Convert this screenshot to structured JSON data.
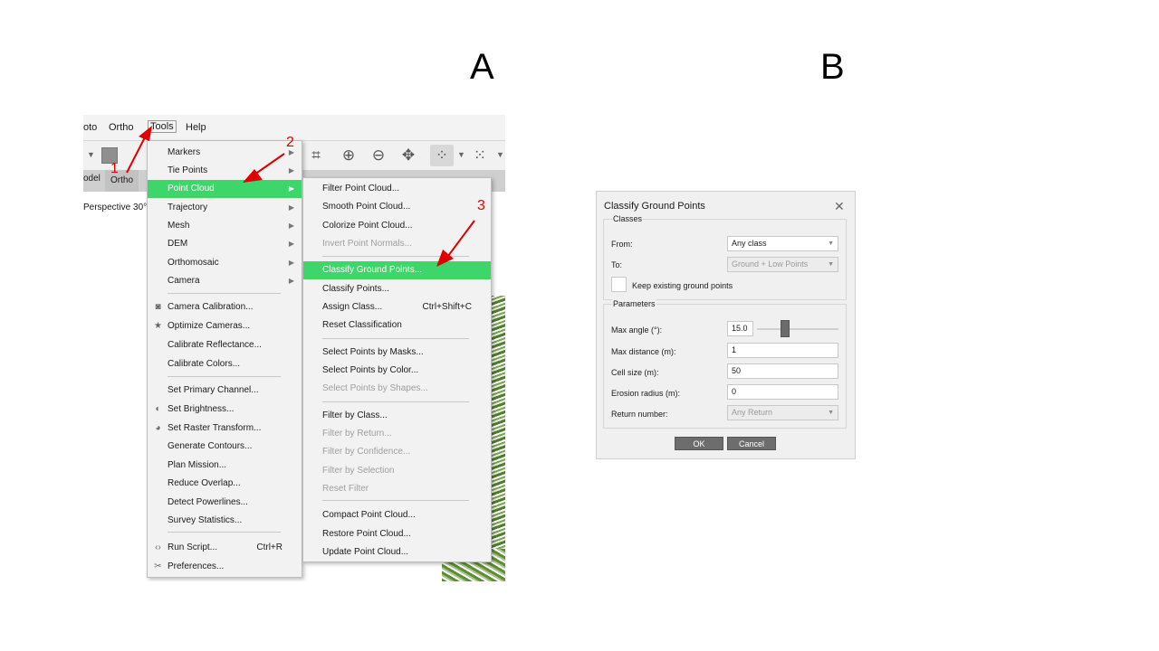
{
  "panel_labels": {
    "a": "A",
    "b": "B"
  },
  "menubar": {
    "photo": "oto",
    "ortho": "Ortho",
    "tools": "Tools",
    "help": "Help"
  },
  "tabs": {
    "model": "odel",
    "ortho": "Ortho"
  },
  "viewport": {
    "perspective": "Perspective 30°"
  },
  "annotations": {
    "one": "1",
    "two": "2",
    "three": "3",
    "color": "#e00000"
  },
  "tools_menu": {
    "items": [
      {
        "label": "Markers",
        "submenu": true
      },
      {
        "label": "Tie Points",
        "submenu": true
      },
      {
        "label": "Point Cloud",
        "submenu": true,
        "highlighted": true
      },
      {
        "label": "Trajectory",
        "submenu": true
      },
      {
        "label": "Mesh",
        "submenu": true
      },
      {
        "label": "DEM",
        "submenu": true
      },
      {
        "label": "Orthomosaic",
        "submenu": true
      },
      {
        "label": "Camera",
        "submenu": true
      },
      {
        "label": "Camera Calibration...",
        "icon": "camera-icon"
      },
      {
        "label": "Optimize Cameras...",
        "icon": "star-icon"
      },
      {
        "label": "Calibrate Reflectance..."
      },
      {
        "label": "Calibrate Colors..."
      },
      {
        "label": "Set Primary Channel..."
      },
      {
        "label": "Set Brightness...",
        "icon": "contrast-icon"
      },
      {
        "label": "Set Raster Transform...",
        "icon": "palette-icon"
      },
      {
        "label": "Generate Contours..."
      },
      {
        "label": "Plan Mission..."
      },
      {
        "label": "Reduce Overlap..."
      },
      {
        "label": "Detect Powerlines..."
      },
      {
        "label": "Survey Statistics..."
      },
      {
        "label": "Run Script...",
        "icon": "code-icon",
        "shortcut": "Ctrl+R"
      },
      {
        "label": "Preferences...",
        "icon": "tools-icon"
      }
    ]
  },
  "point_cloud_menu": {
    "items": [
      {
        "label": "Filter Point Cloud..."
      },
      {
        "label": "Smooth Point Cloud..."
      },
      {
        "label": "Colorize Point Cloud..."
      },
      {
        "label": "Invert Point Normals...",
        "disabled": true
      },
      {
        "label": "Classify Ground Points...",
        "highlighted": true
      },
      {
        "label": "Classify Points..."
      },
      {
        "label": "Assign Class...",
        "shortcut": "Ctrl+Shift+C"
      },
      {
        "label": "Reset Classification"
      },
      {
        "label": "Select Points by Masks..."
      },
      {
        "label": "Select Points by Color..."
      },
      {
        "label": "Select Points by Shapes...",
        "disabled": true
      },
      {
        "label": "Filter by Class..."
      },
      {
        "label": "Filter by Return...",
        "disabled": true
      },
      {
        "label": "Filter by Confidence...",
        "disabled": true
      },
      {
        "label": "Filter by Selection",
        "disabled": true
      },
      {
        "label": "Reset Filter",
        "disabled": true
      },
      {
        "label": "Compact Point Cloud..."
      },
      {
        "label": "Restore Point Cloud..."
      },
      {
        "label": "Update Point Cloud..."
      }
    ]
  },
  "dialog": {
    "title": "Classify Ground Points",
    "classes_group": "Classes",
    "from_label": "From:",
    "from_value": "Any class",
    "to_label": "To:",
    "to_value": "Ground + Low Points",
    "keep_label": "Keep existing ground points",
    "keep_checked": false,
    "params_group": "Parameters",
    "max_angle_label": "Max angle (°):",
    "max_angle_value": "15.0",
    "max_distance_label": "Max distance (m):",
    "max_distance_value": "1",
    "cell_size_label": "Cell size (m):",
    "cell_size_value": "50",
    "erosion_label": "Erosion radius (m):",
    "erosion_value": "0",
    "return_label": "Return number:",
    "return_value": "Any Return",
    "ok": "OK",
    "cancel": "Cancel"
  },
  "colors": {
    "highlight": "#3cd66a",
    "disabled_text": "#9e9e9e",
    "button_bg": "#6d6d6d"
  }
}
